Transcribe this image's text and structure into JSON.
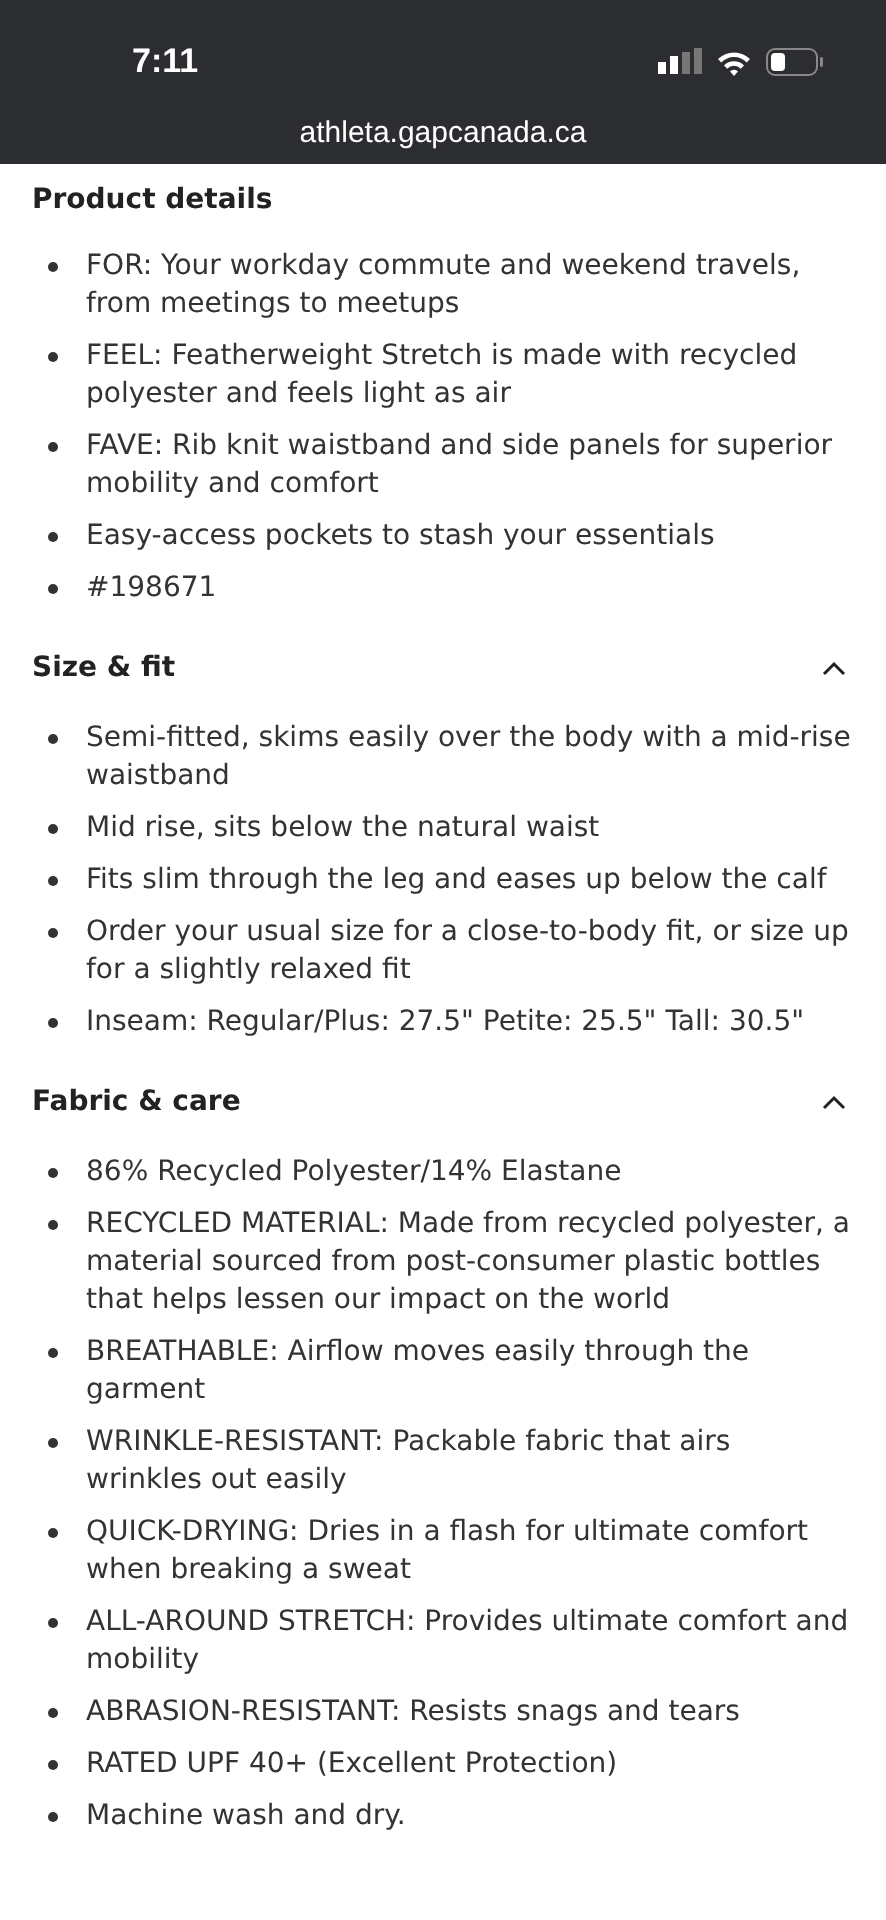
{
  "status_bar": {
    "time": "7:11"
  },
  "address_bar": {
    "url": "athleta.gapcanada.ca"
  },
  "sections": [
    {
      "title": "Product details",
      "items": [
        "FOR: Your workday commute and weekend travels, from meetings to meetups",
        "FEEL: Featherweight Stretch is made with recycled polyester and feels light as air",
        "FAVE: Rib knit waistband and side panels for superior mobility and comfort",
        "Easy-access pockets to stash your essentials",
        "#198671"
      ]
    },
    {
      "title": "Size & fit",
      "expanded": true,
      "items": [
        "Semi-fitted, skims easily over the body with a mid-rise waistband",
        "Mid rise, sits below the natural waist",
        "Fits slim through the leg and eases up below the calf",
        "Order your usual size for a close-to-body fit, or size up for a slightly relaxed fit",
        "Inseam: Regular/Plus: 27.5\" Petite: 25.5\" Tall: 30.5\""
      ]
    },
    {
      "title": "Fabric & care",
      "expanded": true,
      "items": [
        "86% Recycled Polyester/14% Elastane",
        "RECYCLED MATERIAL: Made from recycled polyester, a material sourced from post-consumer plastic bottles that helps lessen our impact on the world",
        "BREATHABLE: Airflow moves easily through the garment",
        "WRINKLE-RESISTANT: Packable fabric that airs wrinkles out easily",
        "QUICK-DRYING: Dries in a flash for ultimate comfort when breaking a sweat",
        "ALL-AROUND STRETCH: Provides ultimate comfort and mobility",
        "ABRASION-RESISTANT: Resists snags and tears",
        "RATED UPF 40+ (Excellent Protection)",
        "Machine wash and dry."
      ]
    }
  ]
}
